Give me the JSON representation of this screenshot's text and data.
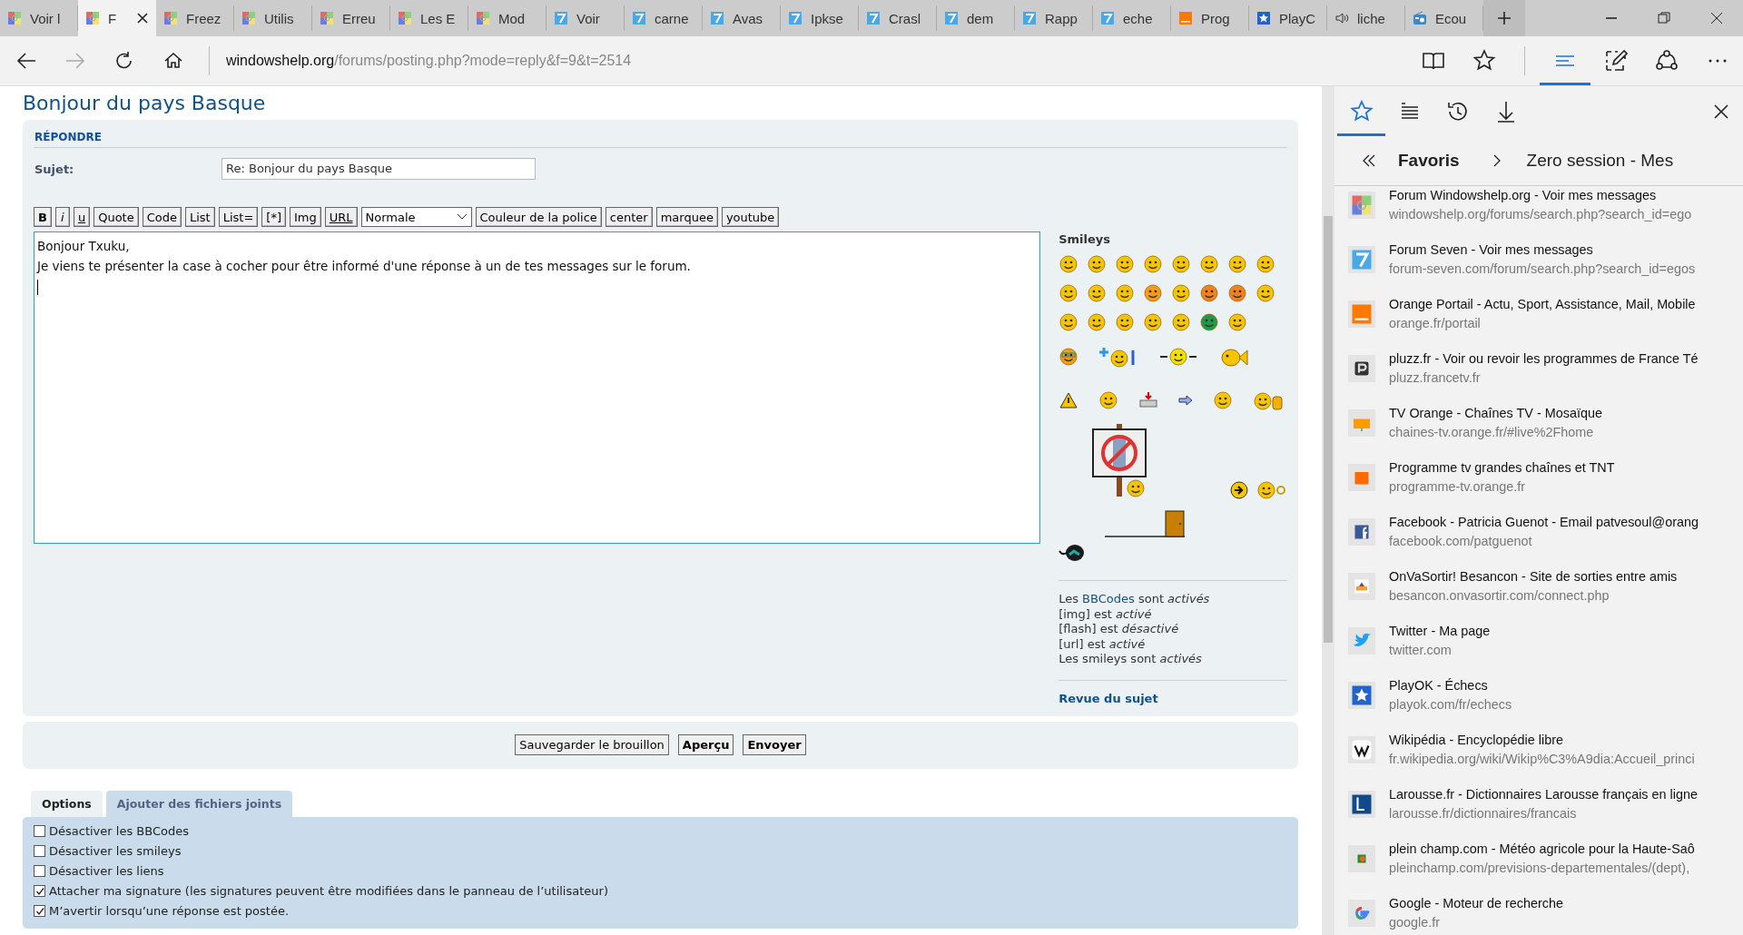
{
  "browser": {
    "tabs": [
      {
        "label": "Voir l",
        "kind": "flag",
        "selected": false
      },
      {
        "label": "F",
        "kind": "flag",
        "selected": true
      },
      {
        "label": "Freez",
        "kind": "flag",
        "selected": false
      },
      {
        "label": "Utilis",
        "kind": "flag",
        "selected": false
      },
      {
        "label": "Erreu",
        "kind": "flag",
        "selected": false
      },
      {
        "label": "Les E",
        "kind": "flag",
        "selected": false
      },
      {
        "label": "Mod",
        "kind": "flag",
        "selected": false
      },
      {
        "label": "Voir",
        "kind": "seven",
        "selected": false
      },
      {
        "label": "carne",
        "kind": "seven",
        "selected": false
      },
      {
        "label": "Avas",
        "kind": "seven",
        "selected": false
      },
      {
        "label": "Ipkse",
        "kind": "seven",
        "selected": false
      },
      {
        "label": "Crasl",
        "kind": "seven",
        "selected": false
      },
      {
        "label": "dem",
        "kind": "seven",
        "selected": false
      },
      {
        "label": "Rapp",
        "kind": "seven",
        "selected": false
      },
      {
        "label": "eche",
        "kind": "seven",
        "selected": false
      },
      {
        "label": "Prog",
        "kind": "orange",
        "selected": false
      },
      {
        "label": "PlayC",
        "kind": "star",
        "selected": false
      },
      {
        "label": "liche",
        "kind": "speaker",
        "selected": false
      },
      {
        "label": "Ecou",
        "kind": "radio",
        "selected": false
      }
    ],
    "address": {
      "domain": "windowshelp.org",
      "path": "/forums/posting.php?mode=reply&f=9&t=2514"
    }
  },
  "page": {
    "title": "Bonjour du pays Basque",
    "reply_heading": "RÉPONDRE",
    "subject_label": "Sujet:",
    "subject_value": "Re: Bonjour du pays Basque",
    "toolbar": [
      {
        "label": "B",
        "kind": "bold"
      },
      {
        "label": "i",
        "kind": "italic"
      },
      {
        "label": "u",
        "kind": "underline"
      },
      {
        "label": "Quote",
        "kind": "plain"
      },
      {
        "label": "Code",
        "kind": "plain"
      },
      {
        "label": "List",
        "kind": "plain"
      },
      {
        "label": "List=",
        "kind": "plain"
      },
      {
        "label": "[*]",
        "kind": "plain"
      },
      {
        "label": "Img",
        "kind": "plain"
      },
      {
        "label": "URL",
        "kind": "underline"
      },
      {
        "label": "Normale",
        "kind": "select"
      },
      {
        "label": "Couleur de la police",
        "kind": "plain"
      },
      {
        "label": "center",
        "kind": "plain"
      },
      {
        "label": "marquee",
        "kind": "plain"
      },
      {
        "label": "youtube",
        "kind": "plain"
      }
    ],
    "message": [
      "Bonjour Txuku,",
      "Je viens te présenter la case à cocher pour être informé d'une réponse à un de tes messages sur le forum."
    ],
    "smileys_title": "Smileys",
    "bbcode_line": {
      "before": "Les",
      "link": "BBCodes",
      "after": "sont *activés*"
    },
    "status_lines": [
      "[img] est *activé*",
      "[flash] est *désactivé*",
      "[url] est *activé*",
      "Les smileys sont *activés*"
    ],
    "review_link": "Revue du sujet",
    "buttons": [
      {
        "label": "Sauvegarder le brouillon",
        "kind": "default"
      },
      {
        "label": "Aperçu",
        "kind": "primary"
      },
      {
        "label": "Envoyer",
        "kind": "primary"
      }
    ],
    "option_tabs": [
      {
        "label": "Options",
        "selected": true
      },
      {
        "label": "Ajouter des fichiers joints",
        "selected": false
      }
    ],
    "options": [
      {
        "label": "Désactiver les BBCodes",
        "checked": false
      },
      {
        "label": "Désactiver les smileys",
        "checked": false
      },
      {
        "label": "Désactiver les liens",
        "checked": false
      },
      {
        "label": "Attacher ma signature (les signatures peuvent être modifiées dans le panneau de l’utilisateur)",
        "checked": true
      },
      {
        "label": "M’avertir lorsqu’une réponse est postée.",
        "checked": true
      }
    ]
  },
  "favorites": {
    "breadcrumb": [
      "Favoris",
      "Zero session - Mes"
    ],
    "items": [
      {
        "title": "Forum Windowshelp.org - Voir mes messages",
        "url": "windowshelp.org/forums/search.php?search_id=ego",
        "kind": "flag"
      },
      {
        "title": "Forum Seven - Voir mes messages",
        "url": "forum-seven.com/forum/search.php?search_id=egos",
        "kind": "seven"
      },
      {
        "title": "Orange Portail - Actu, Sport, Assistance, Mail, Mobile",
        "url": "orange.fr/portail",
        "kind": "orange"
      },
      {
        "title": "pluzz.fr - Voir ou revoir les programmes de France Té",
        "url": "pluzz.francetv.fr",
        "kind": "pluzz"
      },
      {
        "title": "TV Orange - Chaînes TV - Mosaïque",
        "url": "chaines-tv.orange.fr/#live%2Fhome",
        "kind": "tv"
      },
      {
        "title": "Programme tv grandes chaînes et TNT",
        "url": "programme-tv.orange.fr",
        "kind": "orange-small"
      },
      {
        "title": "Facebook - Patricia Guenot - Email patvesoul@orang",
        "url": "facebook.com/patguenot",
        "kind": "facebook"
      },
      {
        "title": "OnVaSortir! Besancon - Site de sorties entre amis",
        "url": "besancon.onvasortir.com/connect.php",
        "kind": "ovs"
      },
      {
        "title": "Twitter - Ma page",
        "url": "twitter.com",
        "kind": "bird"
      },
      {
        "title": "PlayOK - Échecs",
        "url": "playok.com/fr/echecs",
        "kind": "star"
      },
      {
        "title": "Wikipédia - Encyclopédie libre",
        "url": "fr.wikipedia.org/wiki/Wikip%C3%A9dia:Accueil_princi",
        "kind": "wiki"
      },
      {
        "title": "Larousse.fr - Dictionnaires Larousse français en ligne",
        "url": "larousse.fr/dictionnaires/francais",
        "kind": "larousse"
      },
      {
        "title": "plein champ.com - Météo agricole pour la Haute-Saô",
        "url": "pleinchamp.com/previsions-departementales/(dept),",
        "kind": "pleinchamp"
      },
      {
        "title": "Google - Moteur de recherche",
        "url": "google.fr",
        "kind": "google"
      }
    ]
  }
}
